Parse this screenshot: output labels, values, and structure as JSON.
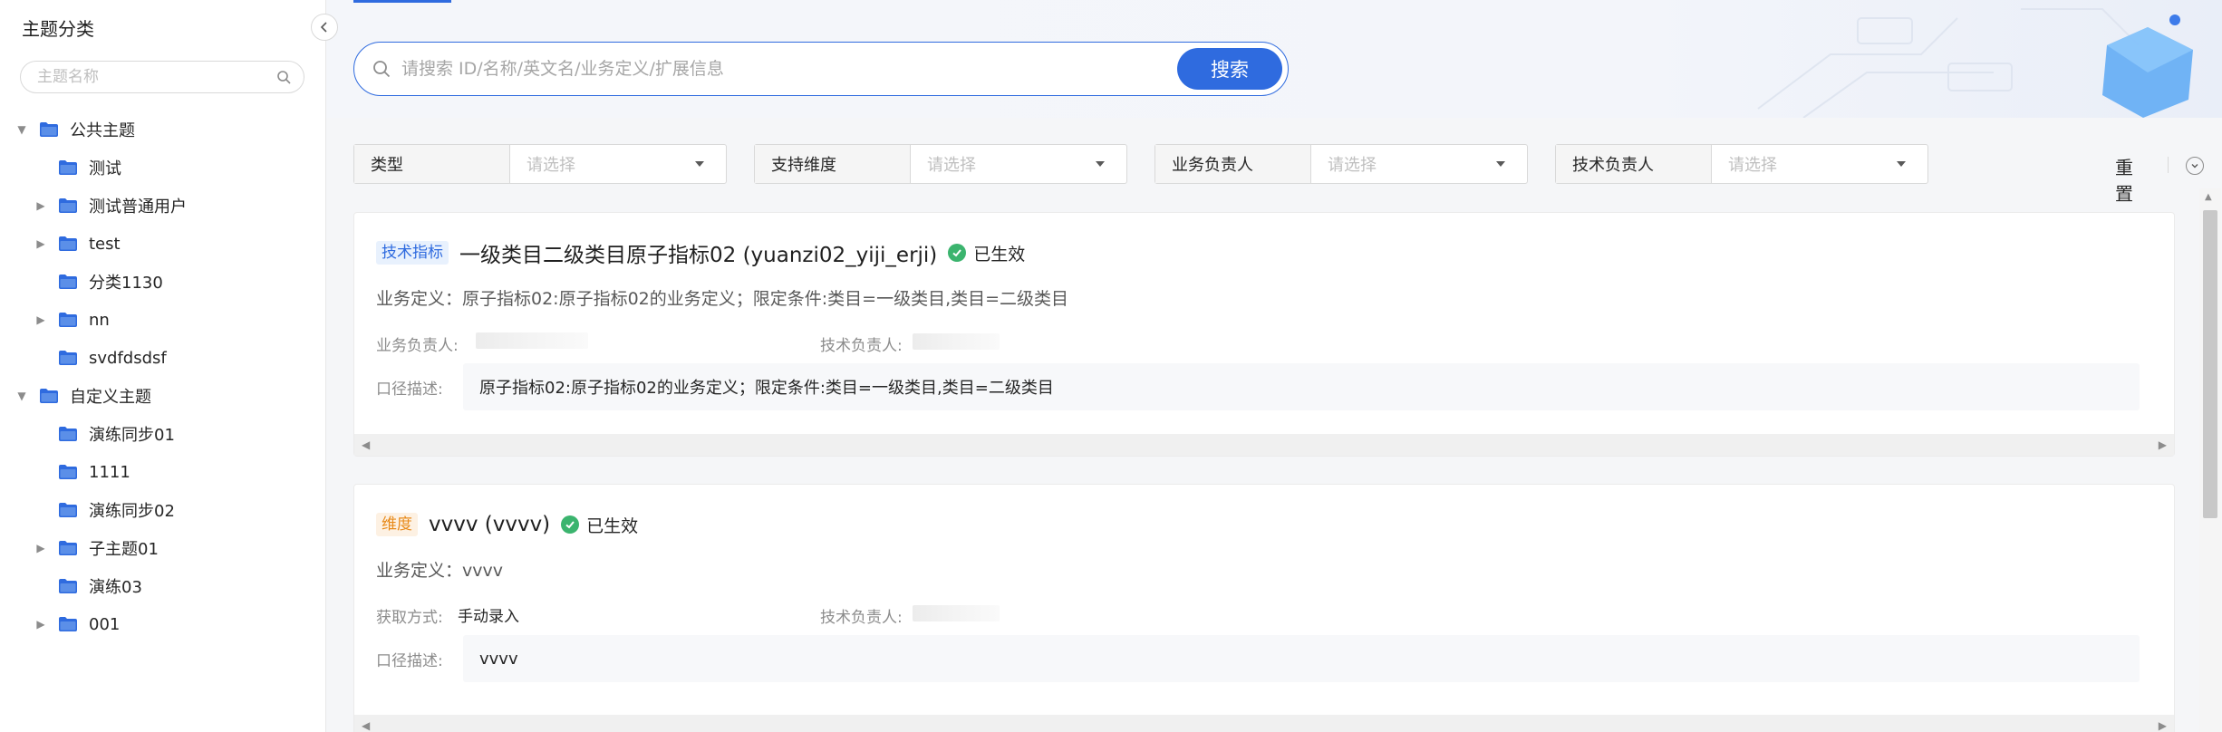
{
  "sidebar": {
    "title": "主题分类",
    "search_placeholder": "主题名称",
    "tree": [
      {
        "label": "公共主题",
        "level": 0,
        "caret": "expanded"
      },
      {
        "label": "测试",
        "level": 1,
        "caret": "none"
      },
      {
        "label": "测试普通用户",
        "level": 1,
        "caret": "collapsed"
      },
      {
        "label": "test",
        "level": 1,
        "caret": "collapsed"
      },
      {
        "label": "分类1130",
        "level": 1,
        "caret": "none"
      },
      {
        "label": "nn",
        "level": 1,
        "caret": "collapsed"
      },
      {
        "label": "svdfdsdsf",
        "level": 1,
        "caret": "none"
      },
      {
        "label": "自定义主题",
        "level": 0,
        "caret": "expanded"
      },
      {
        "label": "演练同步01",
        "level": 1,
        "caret": "none"
      },
      {
        "label": "1111",
        "level": 1,
        "caret": "none"
      },
      {
        "label": "演练同步02",
        "level": 1,
        "caret": "none"
      },
      {
        "label": "子主题01",
        "level": 1,
        "caret": "collapsed"
      },
      {
        "label": "演练03",
        "level": 1,
        "caret": "none"
      },
      {
        "label": "001",
        "level": 1,
        "caret": "collapsed"
      }
    ]
  },
  "search": {
    "placeholder": "请搜索 ID/名称/英文名/业务定义/扩展信息",
    "button_label": "搜索"
  },
  "filters": [
    {
      "label": "类型",
      "placeholder": "请选择"
    },
    {
      "label": "支持维度",
      "placeholder": "请选择"
    },
    {
      "label": "业务负责人",
      "placeholder": "请选择"
    },
    {
      "label": "技术负责人",
      "placeholder": "请选择"
    }
  ],
  "actions": {
    "reset_label": "重置"
  },
  "cards": [
    {
      "tag": "技术指标",
      "tag_color": "#2f6bdf",
      "title": "一级类目二级类目原子指标02 (yuanzi02_yiji_erji)",
      "status": "已生效",
      "biz_def": "业务定义：原子指标02:原子指标02的业务定义；限定条件:类目=一级类目,类目=二级类目",
      "meta_left_label": "业务负责人:",
      "meta_left_value": "",
      "meta_right_label": "技术负责人:",
      "desc_label": "口径描述:",
      "desc_value": "原子指标02:原子指标02的业务定义；限定条件:类目=一级类目,类目=二级类目"
    },
    {
      "tag": "维度",
      "tag_color": "#e88a1a",
      "title": "vvvv (vvvv)",
      "status": "已生效",
      "biz_def": "业务定义：vvvv",
      "meta_left_label": "获取方式:",
      "meta_left_value": "手动录入",
      "meta_right_label": "技术负责人:",
      "desc_label": "口径描述:",
      "desc_value": "vvvv"
    }
  ],
  "colors": {
    "accent": "#2f6bdf",
    "success": "#3bb46e",
    "folder": "#2f6bdf"
  }
}
